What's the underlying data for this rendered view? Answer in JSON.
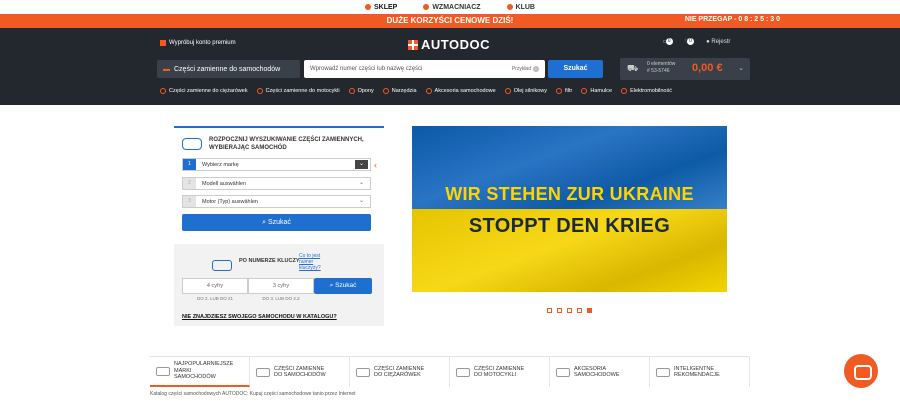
{
  "topnav": {
    "items": [
      "SKLEP",
      "WZMACNIACZ",
      "KLUB"
    ]
  },
  "promo": {
    "text": "DUŻE KORZYŚCI CENOWE DZIŚ!",
    "countdown": "NIE PRZEGAP - 0 8 : 2 5 : 3 0"
  },
  "header": {
    "premium": "Wypróbuj konto premium",
    "logo": "AUTODOC",
    "garage_badge": "0",
    "wishlist_badge": "0",
    "register": "Rejestr",
    "category_button": "Części zamienne do samochodów",
    "search_placeholder": "Wprowadź numer części lub nazwę części",
    "search_example": "Przykład",
    "search_button": "Szukać",
    "cart_line1": "0 elementów",
    "cart_line2": "# 53-5746",
    "cart_price": "0,00 €"
  },
  "categories": [
    "Części zamienne do ciężarówek",
    "Części zamienne do motocykli",
    "Opony",
    "Narzędzia",
    "Akcesoria samochodowe",
    "Olej silnikowy",
    "filtr",
    "Hamulce",
    "Elektromobilność"
  ],
  "selector": {
    "title_line1": "ROZPOCZNIJ WYSZUKIWANIE CZĘŚCI ZAMIENNYCH,",
    "title_line2": "WYBIERAJĄC SAMOCHÓD",
    "step1_num": "1",
    "step1": "Wybierz markę",
    "step2_num": "2",
    "step2": "Modell auswählen",
    "step3_num": "3",
    "step3": "Motor (Typ) auswählen",
    "button": "Szukać"
  },
  "key": {
    "title": "PO NUMERZE KLUCZY",
    "link_line1": "Co to jest",
    "link_line2": "numer",
    "link_line3": "kluczyży?",
    "input1": "4 cyfry",
    "input2": "3 cyfry",
    "hint1": "DO 2. LUB DO 21",
    "hint2": "DO 3. LUB DO 2.2",
    "button": "Szukać",
    "not_found": "NIE ZNAJDZIESZ SWOJEGO SAMOCHODU W KATALOGU?"
  },
  "banner": {
    "line1": "WIR STEHEN ZUR UKRAINE",
    "line2": "STOPPT DEN KRIEG"
  },
  "tabs": [
    {
      "l1": "NAJPOPULARNIEJSZE",
      "l2": "MARKI",
      "l3": "SAMOCHODÓW"
    },
    {
      "l1": "CZĘŚCI ZAMIENNE",
      "l2": "DO SAMOCHODÓW",
      "l3": ""
    },
    {
      "l1": "CZĘŚCI ZAMIENNE",
      "l2": "DO CIĘŻARÓWEK",
      "l3": ""
    },
    {
      "l1": "CZĘŚCI ZAMIENNE",
      "l2": "DO MOTOCYKLI",
      "l3": ""
    },
    {
      "l1": "AKCESORIA",
      "l2": "SAMOCHODOWE",
      "l3": ""
    },
    {
      "l1": "INTELIGENTNE",
      "l2": "REKOMENDACJE",
      "l3": ""
    }
  ],
  "footer": "Katalog części samochodowych AUTODOC: Kupuj części samochodowe tanio przez Internet",
  "colors": {
    "accent": "#f15a22",
    "primary": "#1f6fd0",
    "header_bg": "#23282f"
  }
}
